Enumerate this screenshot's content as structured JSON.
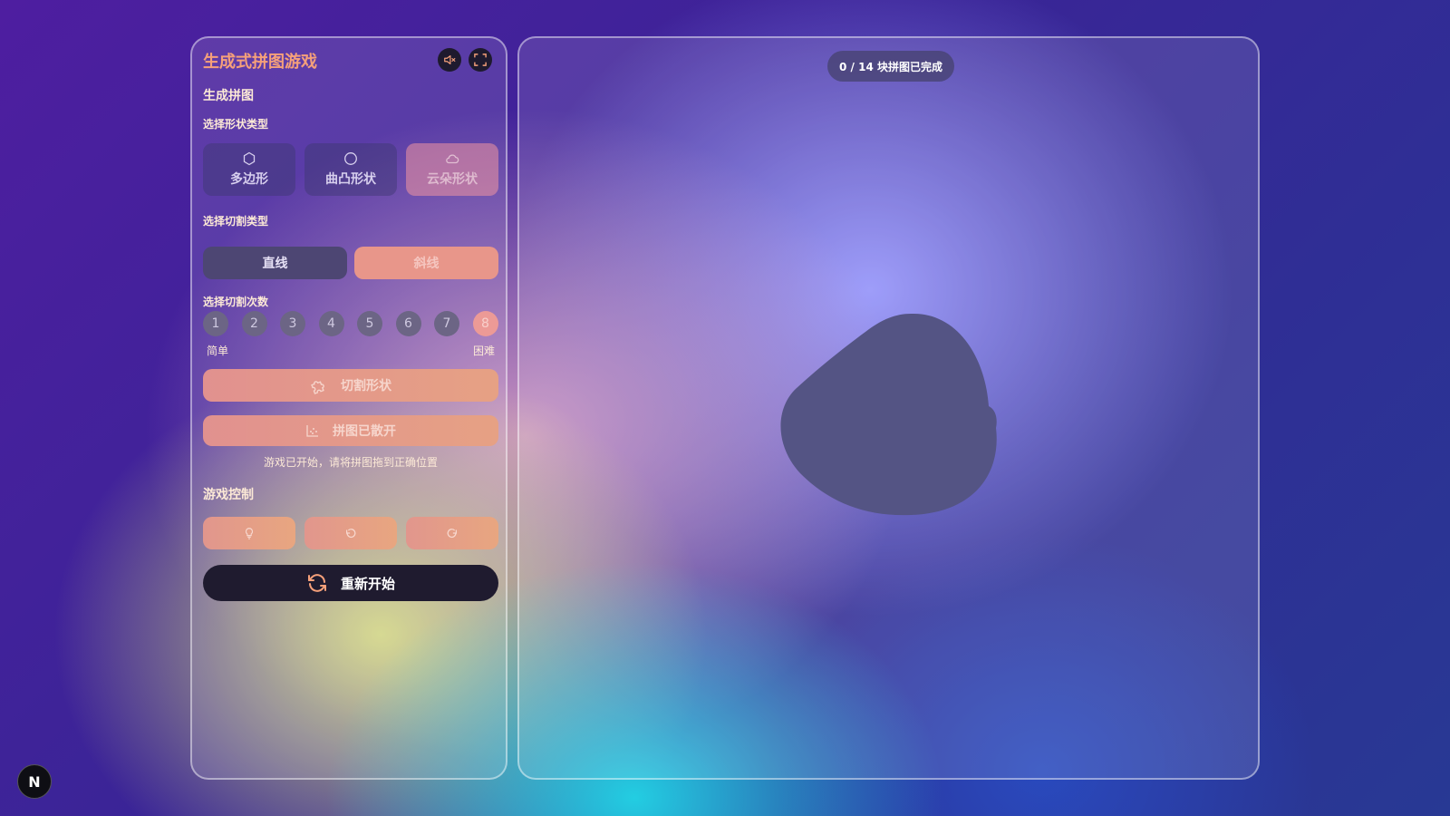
{
  "app": {
    "title": "生成式拼图游戏",
    "mute_icon": "speaker-mute-icon",
    "fullscreen_icon": "fullscreen-icon"
  },
  "generate": {
    "section_title": "生成拼图",
    "shape_type_label": "选择形状类型",
    "shapes": [
      {
        "label": "多边形",
        "icon": "hexagon-icon",
        "selected": false
      },
      {
        "label": "曲凸形状",
        "icon": "circle-icon",
        "selected": false
      },
      {
        "label": "云朵形状",
        "icon": "cloud-icon",
        "selected": true
      }
    ],
    "cut_type_label": "选择切割类型",
    "cut_types": [
      {
        "label": "直线",
        "selected": false
      },
      {
        "label": "斜线",
        "selected": true
      }
    ],
    "cut_count_label": "选择切割次数",
    "cut_counts": [
      "1",
      "2",
      "3",
      "4",
      "5",
      "6",
      "7",
      "8"
    ],
    "selected_cut_count": "8",
    "easy_label": "简单",
    "hard_label": "困难",
    "cut_shape_button": "切割形状",
    "scatter_button": "拼图已散开",
    "status_text": "游戏已开始，请将拼图拖到正确位置"
  },
  "controls": {
    "section_title": "游戏控制",
    "hint_icon": "lightbulb-icon",
    "undo_icon": "undo-icon",
    "redo_icon": "redo-icon",
    "restart_label": "重新开始"
  },
  "board": {
    "progress_text": "0 / 14 块拼图已完成",
    "completed": 0,
    "total": 14,
    "blob_color": "#545484"
  },
  "colors": {
    "accent": "#f5a07a",
    "dark": "#1f1b2f"
  },
  "badge": {
    "letter": "N"
  }
}
